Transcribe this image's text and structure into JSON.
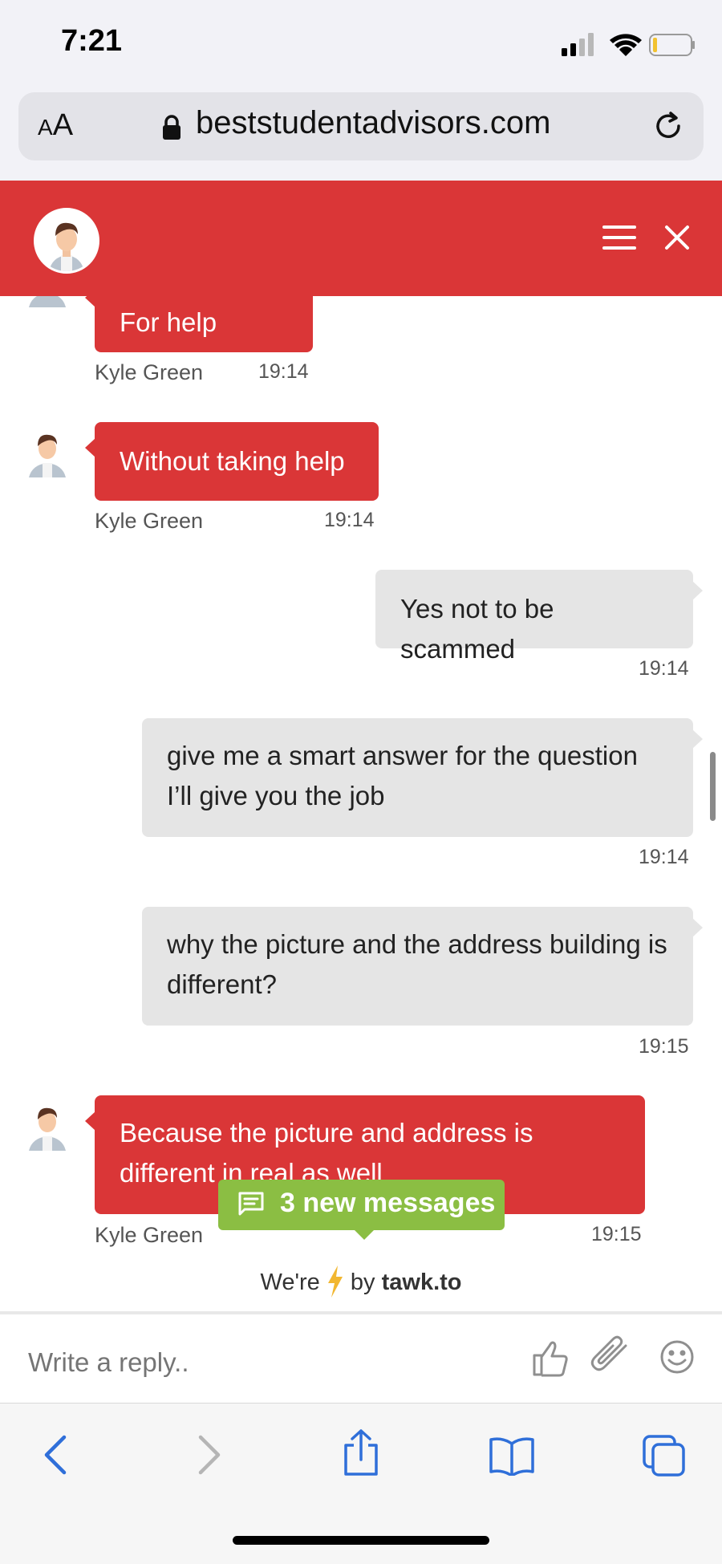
{
  "status_bar": {
    "time": "7:21"
  },
  "browser": {
    "aa_label": "AA",
    "domain": "beststudentadvisors.com"
  },
  "chat": {
    "messages": [
      {
        "from": "agent",
        "text": "For help right?",
        "sender": "Kyle Green",
        "time": "19:14"
      },
      {
        "from": "agent",
        "text": "Without taking help",
        "sender": "Kyle Green",
        "time": "19:14"
      },
      {
        "from": "visitor",
        "text": "Yes not to be scammed",
        "time": "19:14"
      },
      {
        "from": "visitor",
        "text": "give me a smart answer for the question I’ll give you the job",
        "time": "19:14"
      },
      {
        "from": "visitor",
        "text": "why the picture and the address building is different?",
        "time": "19:15"
      },
      {
        "from": "agent",
        "text": "Because the picture and address is different in real as well",
        "sender": "Kyle Green",
        "time": "19:15"
      }
    ],
    "new_messages_label": "3 new messages",
    "powered_prefix": "We're",
    "powered_by": "by",
    "powered_brand": "tawk.to"
  },
  "reply": {
    "placeholder": "Write a reply.."
  },
  "colors": {
    "brand_red": "#da3637",
    "badge_green": "#8bbe43",
    "ios_blue": "#2f6fd9"
  }
}
